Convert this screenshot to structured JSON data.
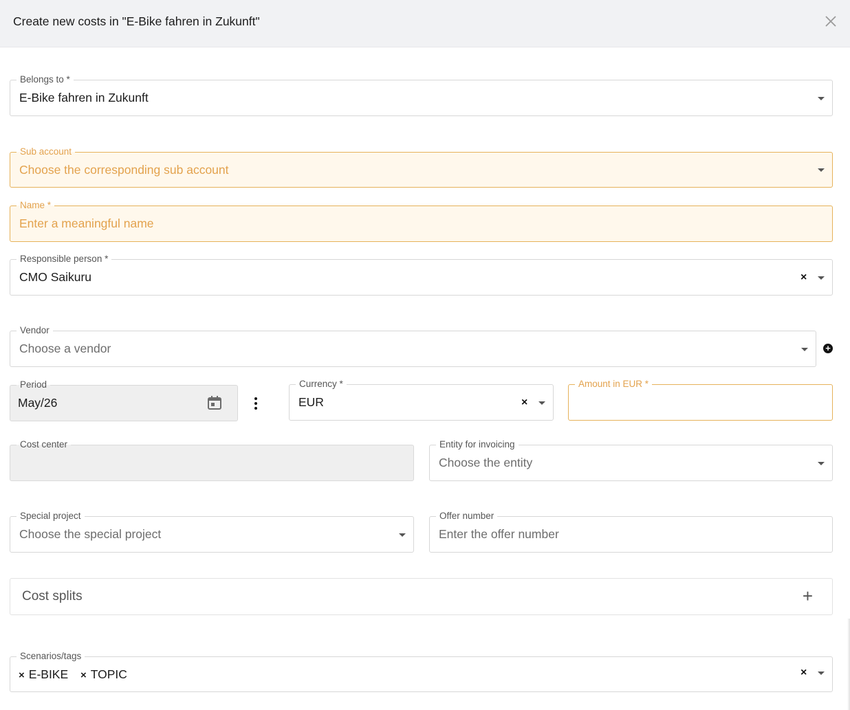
{
  "dialog": {
    "title": "Create new costs in \"E-Bike fahren in Zukunft\""
  },
  "fields": {
    "belongs_to": {
      "label": "Belongs to *",
      "value": "E-Bike fahren in Zukunft"
    },
    "sub_account": {
      "label": "Sub account",
      "placeholder": "Choose the corresponding sub account"
    },
    "name": {
      "label": "Name *",
      "placeholder": "Enter a meaningful name"
    },
    "responsible_person": {
      "label": "Responsible person *",
      "value": "CMO Saikuru"
    },
    "vendor": {
      "label": "Vendor",
      "placeholder": "Choose a vendor"
    },
    "period": {
      "label": "Period",
      "value": "May/26"
    },
    "currency": {
      "label": "Currency *",
      "value": "EUR"
    },
    "amount": {
      "label": "Amount in EUR *",
      "value": ""
    },
    "cost_center": {
      "label": "Cost center",
      "value": ""
    },
    "entity_invoicing": {
      "label": "Entity for invoicing",
      "placeholder": "Choose the entity"
    },
    "special_project": {
      "label": "Special project",
      "placeholder": "Choose the special project"
    },
    "offer_number": {
      "label": "Offer number",
      "placeholder": "Enter the offer number"
    },
    "tags": {
      "label": "Scenarios/tags",
      "items": [
        "E-BIKE",
        "TOPIC"
      ]
    }
  },
  "cost_splits": {
    "title": "Cost splits"
  },
  "icons": {
    "close": "close-icon",
    "caret": "chevron-down-icon",
    "clear": "clear-icon",
    "add_vendor": "plus-circle-icon",
    "calendar": "calendar-icon",
    "more": "kebab-icon",
    "add_split": "plus-icon"
  },
  "colors": {
    "header_bg": "#f1f2f4",
    "warning_border": "#e6b25a",
    "warning_text": "#e3a24d",
    "disabled_bg": "#efefef"
  }
}
